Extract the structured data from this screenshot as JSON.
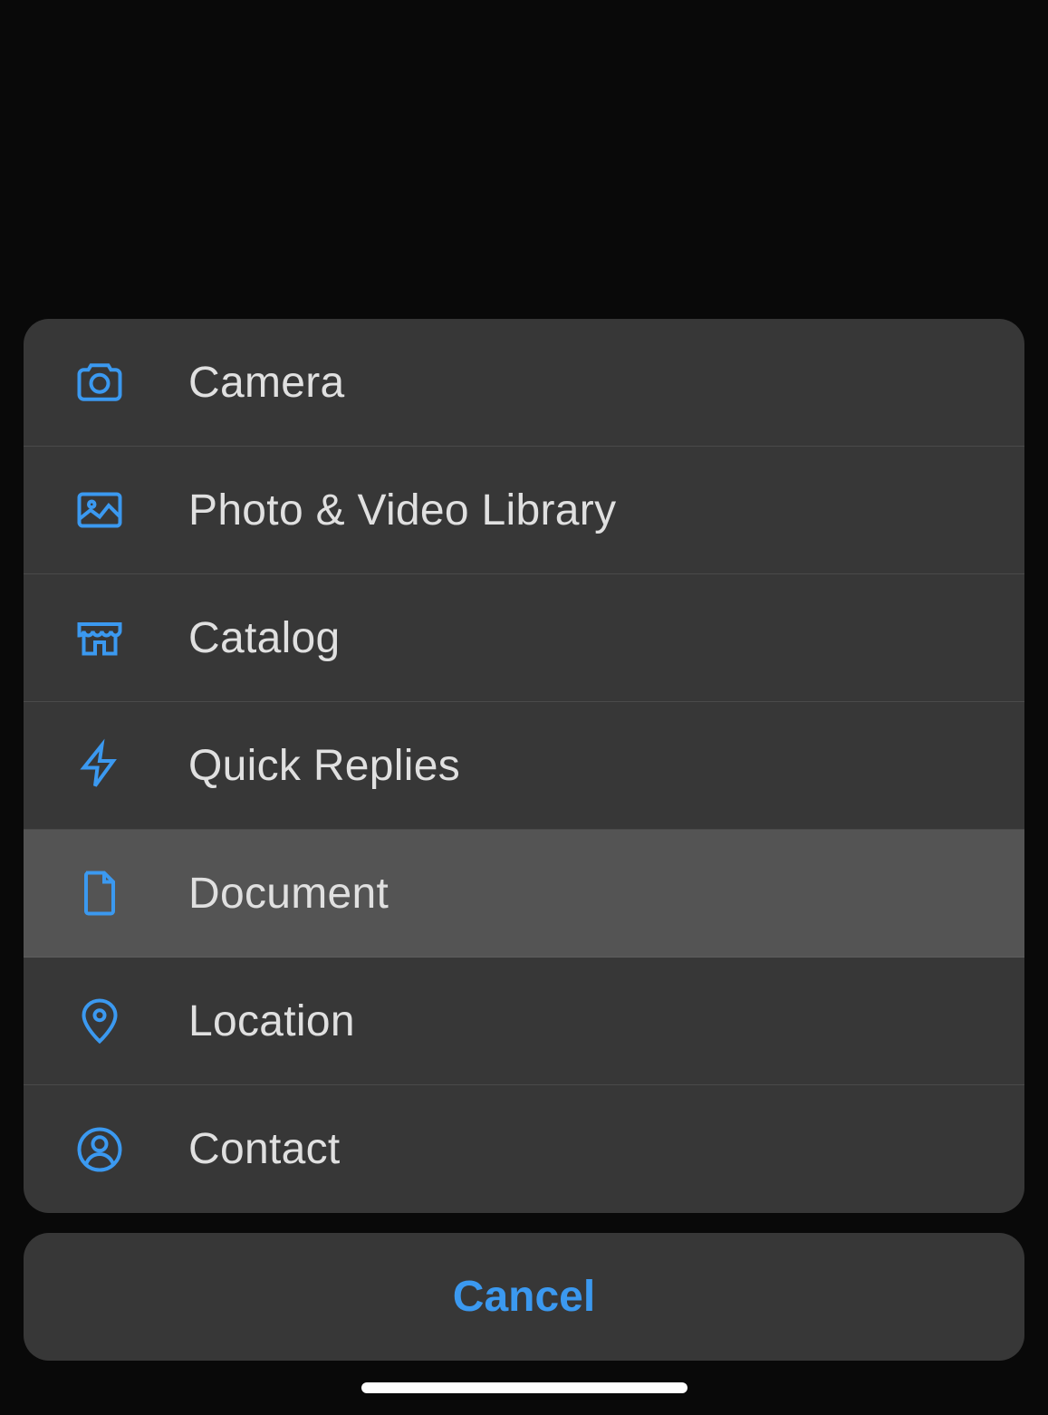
{
  "menu": {
    "items": [
      {
        "id": "camera",
        "label": "Camera",
        "icon": "camera-icon",
        "highlighted": false
      },
      {
        "id": "photo-video",
        "label": "Photo & Video Library",
        "icon": "photo-icon",
        "highlighted": false
      },
      {
        "id": "catalog",
        "label": "Catalog",
        "icon": "storefront-icon",
        "highlighted": false
      },
      {
        "id": "quick-replies",
        "label": "Quick Replies",
        "icon": "lightning-icon",
        "highlighted": false
      },
      {
        "id": "document",
        "label": "Document",
        "icon": "document-icon",
        "highlighted": true
      },
      {
        "id": "location",
        "label": "Location",
        "icon": "location-pin-icon",
        "highlighted": false
      },
      {
        "id": "contact",
        "label": "Contact",
        "icon": "contact-icon",
        "highlighted": false
      }
    ]
  },
  "cancel": {
    "label": "Cancel"
  },
  "colors": {
    "icon": "#3b99f0",
    "text": "#e0e0e0",
    "accent": "#3b99f0"
  }
}
